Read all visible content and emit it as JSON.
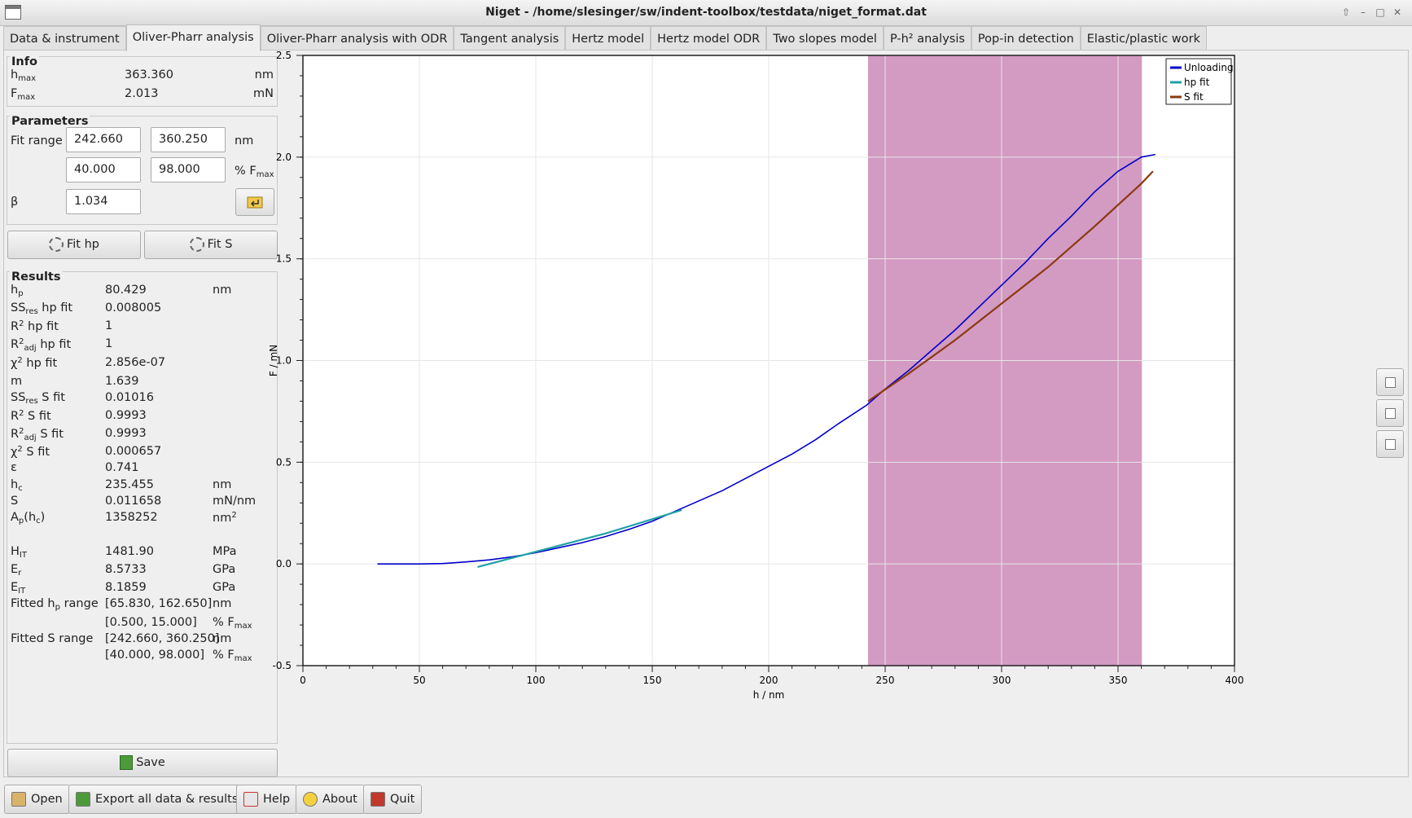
{
  "window": {
    "title": "Niget - /home/slesinger/sw/indent-toolbox/testdata/niget_format.dat",
    "buttons": [
      "⇧",
      "–",
      "□",
      "✕"
    ]
  },
  "tabs": [
    {
      "label": "Data & instrument",
      "active": false
    },
    {
      "label": "Oliver-Pharr analysis",
      "active": true
    },
    {
      "label": "Oliver-Pharr analysis with ODR",
      "active": false
    },
    {
      "label": "Tangent analysis",
      "active": false
    },
    {
      "label": "Hertz model",
      "active": false
    },
    {
      "label": "Hertz model ODR",
      "active": false
    },
    {
      "label": "Two slopes model",
      "active": false
    },
    {
      "label": "P-h² analysis",
      "active": false
    },
    {
      "label": "Pop-in detection",
      "active": false
    },
    {
      "label": "Elastic/plastic work",
      "active": false
    }
  ],
  "info": {
    "title": "Info",
    "hmax": {
      "label": "h",
      "sub": "max",
      "value": "363.360",
      "unit": "nm"
    },
    "fmax": {
      "label": "F",
      "sub": "max",
      "value": "2.013",
      "unit": "mN"
    }
  },
  "parameters": {
    "title": "Parameters",
    "fit_range_label": "Fit range",
    "range_nm_from": "242.660",
    "range_nm_to": "360.250",
    "unit_nm": "nm",
    "range_pct_from": "40.000",
    "range_pct_to": "98.000",
    "unit_pct": "% F",
    "unit_pct_sub": "max",
    "beta_label": "β",
    "beta": "1.034",
    "apply_icon": "arrow-return-icon"
  },
  "fit_buttons": {
    "fit_hp": "Fit hp",
    "fit_s": "Fit S"
  },
  "results": {
    "title": "Results",
    "rows": [
      {
        "k": "h",
        "ks": "p",
        "k2": "",
        "v": "80.429",
        "u": "nm",
        "us": ""
      },
      {
        "k": "SS",
        "ks": "res",
        "k2": " hp fit",
        "v": "0.008005",
        "u": "",
        "us": ""
      },
      {
        "k": "R",
        "ksup": "2",
        "k2": " hp fit",
        "v": "1",
        "u": "",
        "us": ""
      },
      {
        "k": "R",
        "ksup": "2",
        "ks": "adj",
        "k2": " hp fit",
        "v": "1",
        "u": "",
        "us": ""
      },
      {
        "k": "χ",
        "ksup": "2",
        "k2": " hp fit",
        "v": "2.856e-07",
        "u": "",
        "us": ""
      },
      {
        "k": "m",
        "k2": "",
        "v": "1.639",
        "u": "",
        "us": ""
      },
      {
        "k": "SS",
        "ks": "res",
        "k2": " S fit",
        "v": "0.01016",
        "u": "",
        "us": ""
      },
      {
        "k": "R",
        "ksup": "2",
        "k2": " S fit",
        "v": "0.9993",
        "u": "",
        "us": ""
      },
      {
        "k": "R",
        "ksup": "2",
        "ks": "adj",
        "k2": " S fit",
        "v": "0.9993",
        "u": "",
        "us": ""
      },
      {
        "k": "χ",
        "ksup": "2",
        "k2": " S fit",
        "v": "0.000657",
        "u": "",
        "us": ""
      },
      {
        "k": "ε",
        "k2": "",
        "v": "0.741",
        "u": "",
        "us": ""
      },
      {
        "k": "h",
        "ks": "c",
        "k2": "",
        "v": "235.455",
        "u": "nm",
        "us": ""
      },
      {
        "k": "S",
        "k2": "",
        "v": "0.011658",
        "u": "mN/nm",
        "us": ""
      },
      {
        "k": "A",
        "ks": "p",
        "k2": "(h",
        "k3s": "c",
        "k4": ")",
        "v": "1358252",
        "u": "nm",
        "usup": "2"
      },
      {
        "k": "H",
        "ks": "IT",
        "k2": "",
        "v": "1481.90",
        "u": "MPa",
        "us": "",
        "gap": true
      },
      {
        "k": "E",
        "ks": "r",
        "k2": "",
        "v": "8.5733",
        "u": "GPa",
        "us": ""
      },
      {
        "k": "E",
        "ks": "IT",
        "k2": "",
        "v": "8.1859",
        "u": "GPa",
        "us": ""
      },
      {
        "k": "Fitted h",
        "ks": "p",
        "k2": " range",
        "v": "[65.830, 162.650]",
        "u": "nm",
        "us": ""
      },
      {
        "k": "",
        "k2": "",
        "v": "[0.500, 15.000]",
        "u": "% F",
        "us": "max"
      },
      {
        "k": "Fitted S range",
        "k2": "",
        "v": "[242.660, 360.250]",
        "u": "nm",
        "us": ""
      },
      {
        "k": "",
        "k2": "",
        "v": "[40.000, 98.000]",
        "u": "% F",
        "us": "max"
      }
    ]
  },
  "save_button": "Save",
  "bottom_buttons": [
    "Open",
    "Export all data & results",
    "Help",
    "About",
    "Quit"
  ],
  "plot_side_buttons": [
    "zoom-in-icon",
    "zoom-out-icon",
    "zoom-fit-icon"
  ],
  "chart_data": {
    "type": "line",
    "title": "",
    "xlabel": "h / nm",
    "ylabel": "F / mN",
    "xlim": [
      0,
      400
    ],
    "ylim": [
      -0.5,
      2.5
    ],
    "xticks": [
      0,
      50,
      100,
      150,
      200,
      250,
      300,
      350,
      400
    ],
    "yticks": [
      -0.5,
      0.0,
      0.5,
      1.0,
      1.5,
      2.0,
      2.5
    ],
    "xtick_labels": [
      "0",
      "50",
      "100",
      "150",
      "200",
      "250",
      "300",
      "350",
      "400"
    ],
    "ytick_labels": [
      "-0.5",
      "0.0",
      "0.5",
      "1.0",
      "1.5",
      "2.0",
      "2.5"
    ],
    "grid": true,
    "legend": "top-right",
    "highlight_range": {
      "x": [
        242.66,
        360.25
      ],
      "color": "#d39ac2"
    },
    "series": [
      {
        "name": "Unloading",
        "color": "#0000cc",
        "x": [
          32,
          50,
          60,
          70,
          80,
          90,
          100,
          110,
          120,
          130,
          140,
          150,
          160,
          170,
          180,
          190,
          200,
          210,
          220,
          230,
          242,
          250,
          260,
          270,
          280,
          290,
          300,
          310,
          320,
          330,
          340,
          350,
          360,
          366
        ],
        "y": [
          0.0,
          0.0,
          0.002,
          0.01,
          0.02,
          0.035,
          0.055,
          0.08,
          0.105,
          0.135,
          0.17,
          0.21,
          0.26,
          0.31,
          0.36,
          0.42,
          0.48,
          0.54,
          0.61,
          0.69,
          0.78,
          0.86,
          0.95,
          1.05,
          1.15,
          1.26,
          1.37,
          1.48,
          1.6,
          1.71,
          1.83,
          1.93,
          2.0,
          2.013
        ]
      },
      {
        "name": "hp fit",
        "color": "#20a0a8",
        "x": [
          75,
          90,
          100,
          110,
          120,
          130,
          140,
          150,
          162.65
        ],
        "y": [
          -0.015,
          0.03,
          0.06,
          0.09,
          0.12,
          0.15,
          0.185,
          0.22,
          0.265
        ]
      },
      {
        "name": "S fit",
        "color": "#8b3a10",
        "x": [
          242.66,
          260,
          280,
          300,
          320,
          340,
          360,
          365
        ],
        "y": [
          0.8,
          0.935,
          1.1,
          1.28,
          1.46,
          1.66,
          1.87,
          1.93
        ]
      }
    ]
  }
}
